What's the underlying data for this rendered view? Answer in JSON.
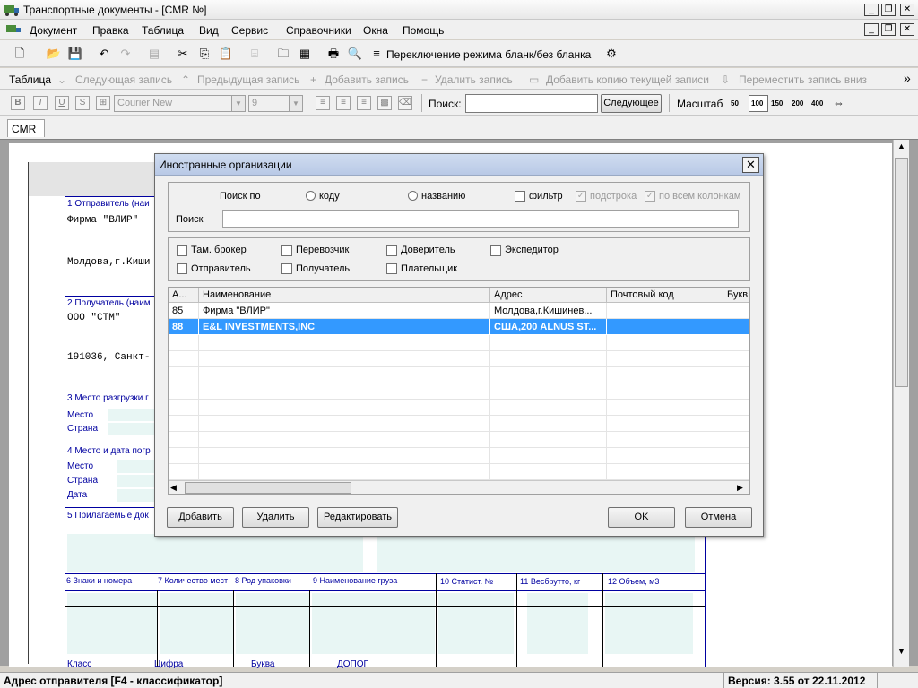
{
  "window": {
    "title": "Транспортные документы - [CMR №]"
  },
  "menu": [
    "Документ",
    "Правка",
    "Таблица",
    "Вид",
    "Сервис",
    "Справочники",
    "Окна",
    "Помощь"
  ],
  "toolbar1": {
    "toggle_label": "Переключение режима бланк/без бланка"
  },
  "toolbar2": {
    "table_label": "Таблица",
    "next_record": "Следующая запись",
    "prev_record": "Предыдущая запись",
    "add_record": "Добавить запись",
    "delete_record": "Удалить запись",
    "add_copy": "Добавить копию текущей записи",
    "move_down": "Переместить запись вниз",
    "overflow": "»"
  },
  "toolbar3": {
    "font_name": "Courier New",
    "font_size": "9",
    "search_label": "Поиск:",
    "search_value": "",
    "next_button": "Следующее",
    "scale_label": "Масштаб",
    "scales": [
      "50",
      "100",
      "150",
      "200",
      "400"
    ]
  },
  "tabs": [
    "CMR"
  ],
  "form": {
    "sender_label": "1 Отправитель (наи",
    "sender_name": "Фирма \"ВЛИР\"",
    "sender_addr": "Молдова,г.Киши",
    "consignee_label": "2 Получатель (наим",
    "consignee_name": "ООО \"СТМ\"",
    "consignee_addr": "191036, Санкт-",
    "unload_label": "3 Место разгрузки г",
    "place": "Место",
    "country": "Страна",
    "loading_label": "4 Место и дата погр",
    "place2": "Место",
    "country2": "Страна",
    "date": "Дата",
    "docs_label": "5 Прилагаемые док",
    "col6": "6 Знаки и номера",
    "col7": "7 Количество мест",
    "col8": "8 Род упаковки",
    "col9": "9 Наименование груза",
    "col10": "10 Статист. №",
    "col11": "11 Весбрутто, кг",
    "col12": "12 Объем, м3",
    "bottom1": "Класс",
    "bottom2": "Цифра",
    "bottom3": "Буква",
    "bottom4": "ДОПОГ"
  },
  "dialog": {
    "title": "Иностранные организации",
    "search_by": "Поиск по",
    "opt_code": "коду",
    "opt_name": "названию",
    "filter": "фильтр",
    "substring": "подстрока",
    "all_columns": "по всем колонкам",
    "search_label": "Поиск",
    "search_value": "",
    "roles": [
      "Там. брокер",
      "Перевозчик",
      "Доверитель",
      "Экспедитор",
      "Отправитель",
      "Получатель",
      "Плательщик"
    ],
    "columns": [
      "А...",
      "Наименование",
      "Адрес",
      "Почтовый код",
      "Букв"
    ],
    "rows": [
      {
        "id": "85",
        "name": "Фирма \"ВЛИР\"",
        "addr": "Молдова,г.Кишинев...",
        "zip": "",
        "sel": false
      },
      {
        "id": "88",
        "name": "E&L INVESTMENTS,INC",
        "addr": "США,200 ALNUS ST...",
        "zip": "",
        "sel": true
      }
    ],
    "btn_add": "Добавить",
    "btn_delete": "Удалить",
    "btn_edit": "Редактировать",
    "btn_ok": "OK",
    "btn_cancel": "Отмена"
  },
  "status": {
    "left": "Адрес отправителя [F4 - классификатор]",
    "right": "Версия: 3.55 от 22.11.2012"
  }
}
